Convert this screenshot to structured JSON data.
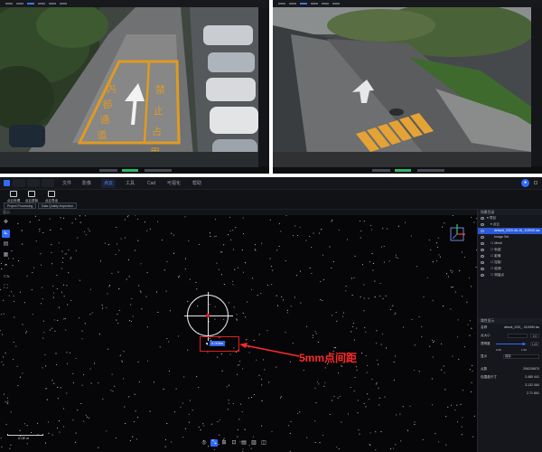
{
  "annotation": {
    "label": "5mm点间距",
    "measurement": "0.005m"
  },
  "app": {
    "menu": [
      "文件",
      "影像",
      "点云",
      "工具",
      "Cad",
      "可视化",
      "帮助"
    ],
    "active_menu": 2,
    "ribbon": [
      {
        "label": "点云处理",
        "icon": "process-icon"
      },
      {
        "label": "点云质检",
        "icon": "inspect-icon"
      },
      {
        "label": "点云导出",
        "icon": "export-icon"
      }
    ],
    "ribbon_buttons": [
      "Project Processing",
      "Data Quality Inspection"
    ],
    "viewport_tab": "显示",
    "scale_bar": "0.02 m",
    "left_tools": [
      "cursor-icon",
      "measure-icon",
      "layers-icon",
      "grid-icon",
      "camera-icon",
      "box-icon",
      "fit-icon"
    ],
    "bottom_tools": [
      "view-icon",
      "measure-icon",
      "ruler-icon",
      "area-icon",
      "section-icon",
      "crop-icon",
      "settings-icon"
    ]
  },
  "right_panel": {
    "tree_title": "场景目录",
    "tree": [
      {
        "label": "▾ 项目",
        "indent": 1,
        "selected": false
      },
      {
        "label": "▾ 点云",
        "indent": 2,
        "selected": false
      },
      {
        "label": "default_2020-06-16_115949.las",
        "indent": 3,
        "selected": true
      },
      {
        "label": "Image Set",
        "indent": 3,
        "selected": false
      },
      {
        "label": "☐ Mesh",
        "indent": 2,
        "selected": false
      },
      {
        "label": "☐ 轨迹",
        "indent": 2,
        "selected": false
      },
      {
        "label": "☐ 影像",
        "indent": 2,
        "selected": false
      },
      {
        "label": "☐ 控制",
        "indent": 2,
        "selected": false
      },
      {
        "label": "☐ 检测",
        "indent": 2,
        "selected": false
      },
      {
        "label": "☐ 测量点",
        "indent": 2,
        "selected": false
      }
    ],
    "props_title": "属性显示",
    "props": {
      "name_key": "名称",
      "name_val": "default_2020_..0115949.las",
      "size_key": "点大小",
      "size_box": "2.0",
      "opacity_key": "透明度",
      "opacity_box": "1.00",
      "opacity_min": "0.00",
      "opacity_max": "1.00",
      "color_key": "显示",
      "color_val": "真彩",
      "points_key": "点数",
      "points_val": "206226870",
      "extent_key": "包围盒尺寸",
      "extent_x": "3.485 441",
      "extent_y": "3.132 084",
      "extent_z": "2.71 851"
    }
  },
  "colors": {
    "accent": "#2f6bff",
    "annotation": "#ff2a2a"
  }
}
